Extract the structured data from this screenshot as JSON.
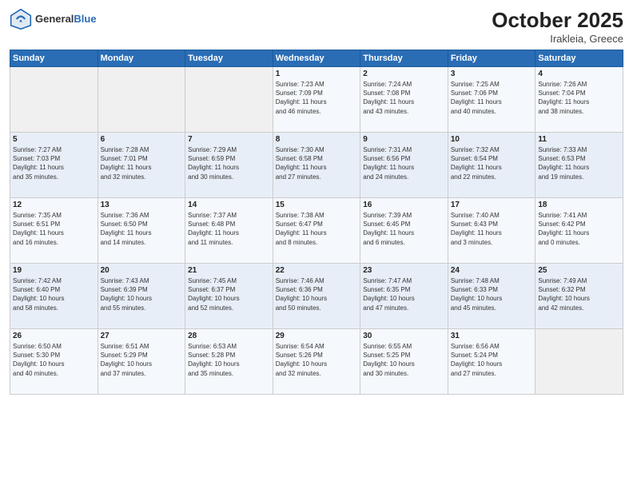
{
  "header": {
    "logo_general": "General",
    "logo_blue": "Blue",
    "month": "October 2025",
    "location": "Irakleia, Greece"
  },
  "days_of_week": [
    "Sunday",
    "Monday",
    "Tuesday",
    "Wednesday",
    "Thursday",
    "Friday",
    "Saturday"
  ],
  "weeks": [
    [
      {
        "day": "",
        "info": ""
      },
      {
        "day": "",
        "info": ""
      },
      {
        "day": "",
        "info": ""
      },
      {
        "day": "1",
        "info": "Sunrise: 7:23 AM\nSunset: 7:09 PM\nDaylight: 11 hours\nand 46 minutes."
      },
      {
        "day": "2",
        "info": "Sunrise: 7:24 AM\nSunset: 7:08 PM\nDaylight: 11 hours\nand 43 minutes."
      },
      {
        "day": "3",
        "info": "Sunrise: 7:25 AM\nSunset: 7:06 PM\nDaylight: 11 hours\nand 40 minutes."
      },
      {
        "day": "4",
        "info": "Sunrise: 7:26 AM\nSunset: 7:04 PM\nDaylight: 11 hours\nand 38 minutes."
      }
    ],
    [
      {
        "day": "5",
        "info": "Sunrise: 7:27 AM\nSunset: 7:03 PM\nDaylight: 11 hours\nand 35 minutes."
      },
      {
        "day": "6",
        "info": "Sunrise: 7:28 AM\nSunset: 7:01 PM\nDaylight: 11 hours\nand 32 minutes."
      },
      {
        "day": "7",
        "info": "Sunrise: 7:29 AM\nSunset: 6:59 PM\nDaylight: 11 hours\nand 30 minutes."
      },
      {
        "day": "8",
        "info": "Sunrise: 7:30 AM\nSunset: 6:58 PM\nDaylight: 11 hours\nand 27 minutes."
      },
      {
        "day": "9",
        "info": "Sunrise: 7:31 AM\nSunset: 6:56 PM\nDaylight: 11 hours\nand 24 minutes."
      },
      {
        "day": "10",
        "info": "Sunrise: 7:32 AM\nSunset: 6:54 PM\nDaylight: 11 hours\nand 22 minutes."
      },
      {
        "day": "11",
        "info": "Sunrise: 7:33 AM\nSunset: 6:53 PM\nDaylight: 11 hours\nand 19 minutes."
      }
    ],
    [
      {
        "day": "12",
        "info": "Sunrise: 7:35 AM\nSunset: 6:51 PM\nDaylight: 11 hours\nand 16 minutes."
      },
      {
        "day": "13",
        "info": "Sunrise: 7:36 AM\nSunset: 6:50 PM\nDaylight: 11 hours\nand 14 minutes."
      },
      {
        "day": "14",
        "info": "Sunrise: 7:37 AM\nSunset: 6:48 PM\nDaylight: 11 hours\nand 11 minutes."
      },
      {
        "day": "15",
        "info": "Sunrise: 7:38 AM\nSunset: 6:47 PM\nDaylight: 11 hours\nand 8 minutes."
      },
      {
        "day": "16",
        "info": "Sunrise: 7:39 AM\nSunset: 6:45 PM\nDaylight: 11 hours\nand 6 minutes."
      },
      {
        "day": "17",
        "info": "Sunrise: 7:40 AM\nSunset: 6:43 PM\nDaylight: 11 hours\nand 3 minutes."
      },
      {
        "day": "18",
        "info": "Sunrise: 7:41 AM\nSunset: 6:42 PM\nDaylight: 11 hours\nand 0 minutes."
      }
    ],
    [
      {
        "day": "19",
        "info": "Sunrise: 7:42 AM\nSunset: 6:40 PM\nDaylight: 10 hours\nand 58 minutes."
      },
      {
        "day": "20",
        "info": "Sunrise: 7:43 AM\nSunset: 6:39 PM\nDaylight: 10 hours\nand 55 minutes."
      },
      {
        "day": "21",
        "info": "Sunrise: 7:45 AM\nSunset: 6:37 PM\nDaylight: 10 hours\nand 52 minutes."
      },
      {
        "day": "22",
        "info": "Sunrise: 7:46 AM\nSunset: 6:36 PM\nDaylight: 10 hours\nand 50 minutes."
      },
      {
        "day": "23",
        "info": "Sunrise: 7:47 AM\nSunset: 6:35 PM\nDaylight: 10 hours\nand 47 minutes."
      },
      {
        "day": "24",
        "info": "Sunrise: 7:48 AM\nSunset: 6:33 PM\nDaylight: 10 hours\nand 45 minutes."
      },
      {
        "day": "25",
        "info": "Sunrise: 7:49 AM\nSunset: 6:32 PM\nDaylight: 10 hours\nand 42 minutes."
      }
    ],
    [
      {
        "day": "26",
        "info": "Sunrise: 6:50 AM\nSunset: 5:30 PM\nDaylight: 10 hours\nand 40 minutes."
      },
      {
        "day": "27",
        "info": "Sunrise: 6:51 AM\nSunset: 5:29 PM\nDaylight: 10 hours\nand 37 minutes."
      },
      {
        "day": "28",
        "info": "Sunrise: 6:53 AM\nSunset: 5:28 PM\nDaylight: 10 hours\nand 35 minutes."
      },
      {
        "day": "29",
        "info": "Sunrise: 6:54 AM\nSunset: 5:26 PM\nDaylight: 10 hours\nand 32 minutes."
      },
      {
        "day": "30",
        "info": "Sunrise: 6:55 AM\nSunset: 5:25 PM\nDaylight: 10 hours\nand 30 minutes."
      },
      {
        "day": "31",
        "info": "Sunrise: 6:56 AM\nSunset: 5:24 PM\nDaylight: 10 hours\nand 27 minutes."
      },
      {
        "day": "",
        "info": ""
      }
    ]
  ]
}
